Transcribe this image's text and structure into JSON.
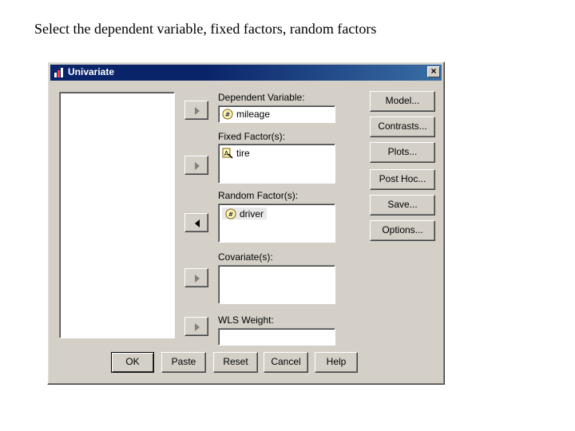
{
  "caption": "Select the dependent variable, fixed factors, random factors",
  "window": {
    "title": "Univariate",
    "close": "×"
  },
  "fields": {
    "dependent": {
      "label": "Dependent Variable:",
      "value": "mileage"
    },
    "fixed": {
      "label": "Fixed Factor(s):",
      "items": [
        "tire"
      ]
    },
    "random": {
      "label": "Random Factor(s):",
      "items": [
        "driver"
      ]
    },
    "covariates": {
      "label": "Covariate(s):"
    },
    "wls": {
      "label": "WLS Weight:"
    }
  },
  "side_buttons": {
    "model": "Model...",
    "contrasts": "Contrasts...",
    "plots": "Plots...",
    "posthoc": "Post Hoc...",
    "save": "Save...",
    "options": "Options..."
  },
  "bottom_buttons": {
    "ok": "OK",
    "paste": "Paste",
    "reset": "Reset",
    "cancel": "Cancel",
    "help": "Help"
  }
}
